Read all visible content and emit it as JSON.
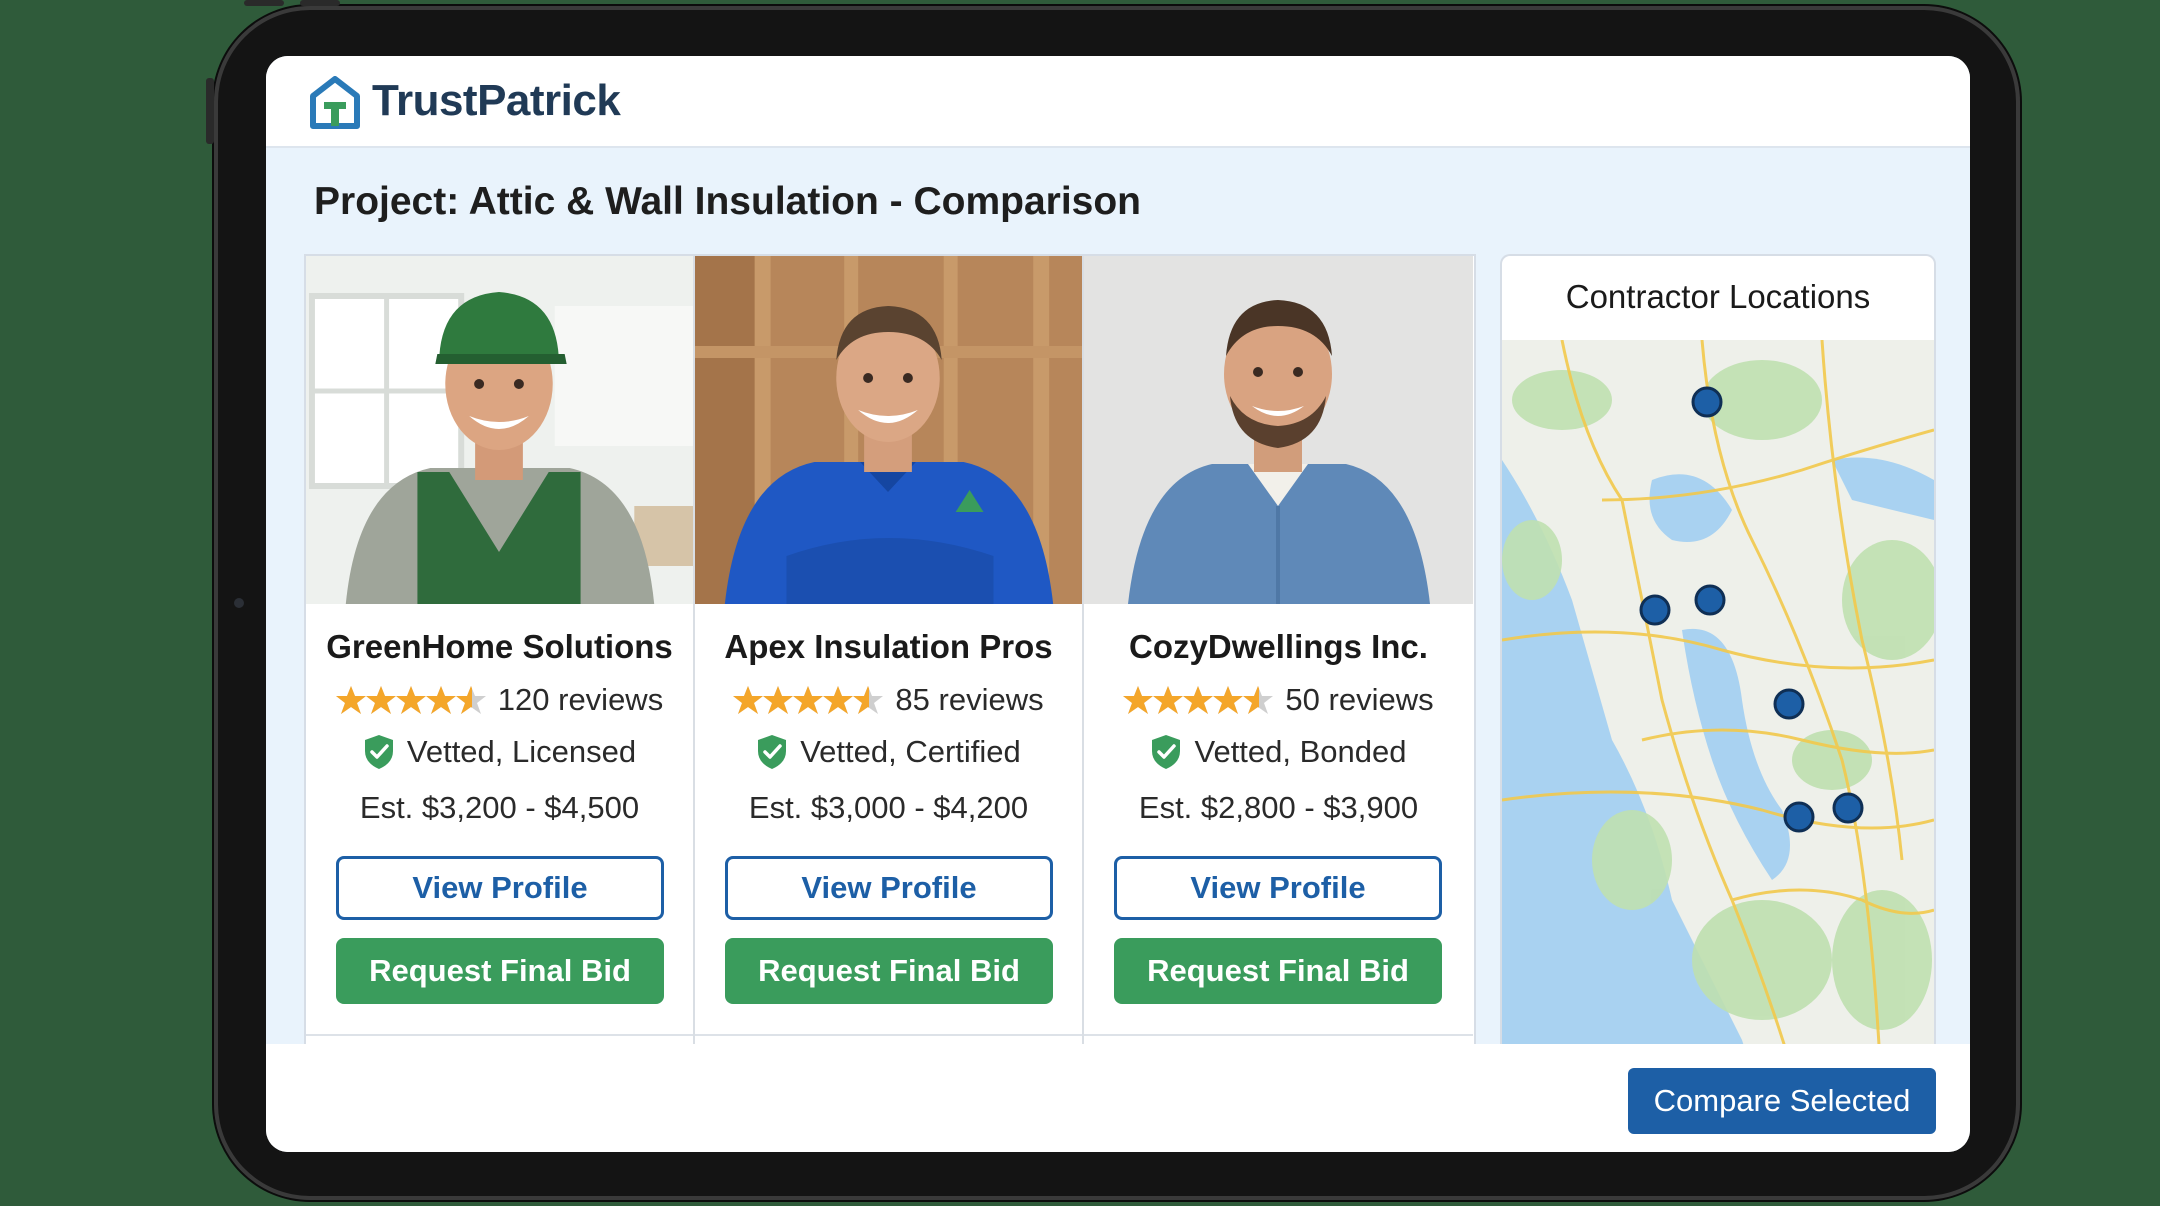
{
  "app": {
    "brand": "TrustPatrick"
  },
  "project": {
    "title": "Project: Attic & Wall Insulation - Comparison"
  },
  "contractors": [
    {
      "name": "GreenHome Solutions",
      "rating": 4.5,
      "reviews": "120 reviews",
      "vetted": "Vetted, Licensed",
      "estimate": "Est. $3,200 - $4,500",
      "view_label": "View Profile",
      "bid_label": "Request Final Bid"
    },
    {
      "name": "Apex Insulation Pros",
      "rating": 4.5,
      "reviews": "85 reviews",
      "vetted": "Vetted, Certified",
      "estimate": "Est. $3,000 - $4,200",
      "view_label": "View Profile",
      "bid_label": "Request Final Bid"
    },
    {
      "name": "CozyDwellings Inc.",
      "rating": 4.5,
      "reviews": "50 reviews",
      "vetted": "Vetted, Bonded",
      "estimate": "Est. $2,800 - $3,900",
      "view_label": "View Profile",
      "bid_label": "Request Final Bid"
    }
  ],
  "map": {
    "title": "Contractor Locations"
  },
  "footer": {
    "compare_label": "Compare Selected"
  },
  "colors": {
    "primary": "#1d5fa6",
    "success": "#3a9c5c",
    "star": "#f4a62a",
    "brand_text": "#203a56"
  }
}
